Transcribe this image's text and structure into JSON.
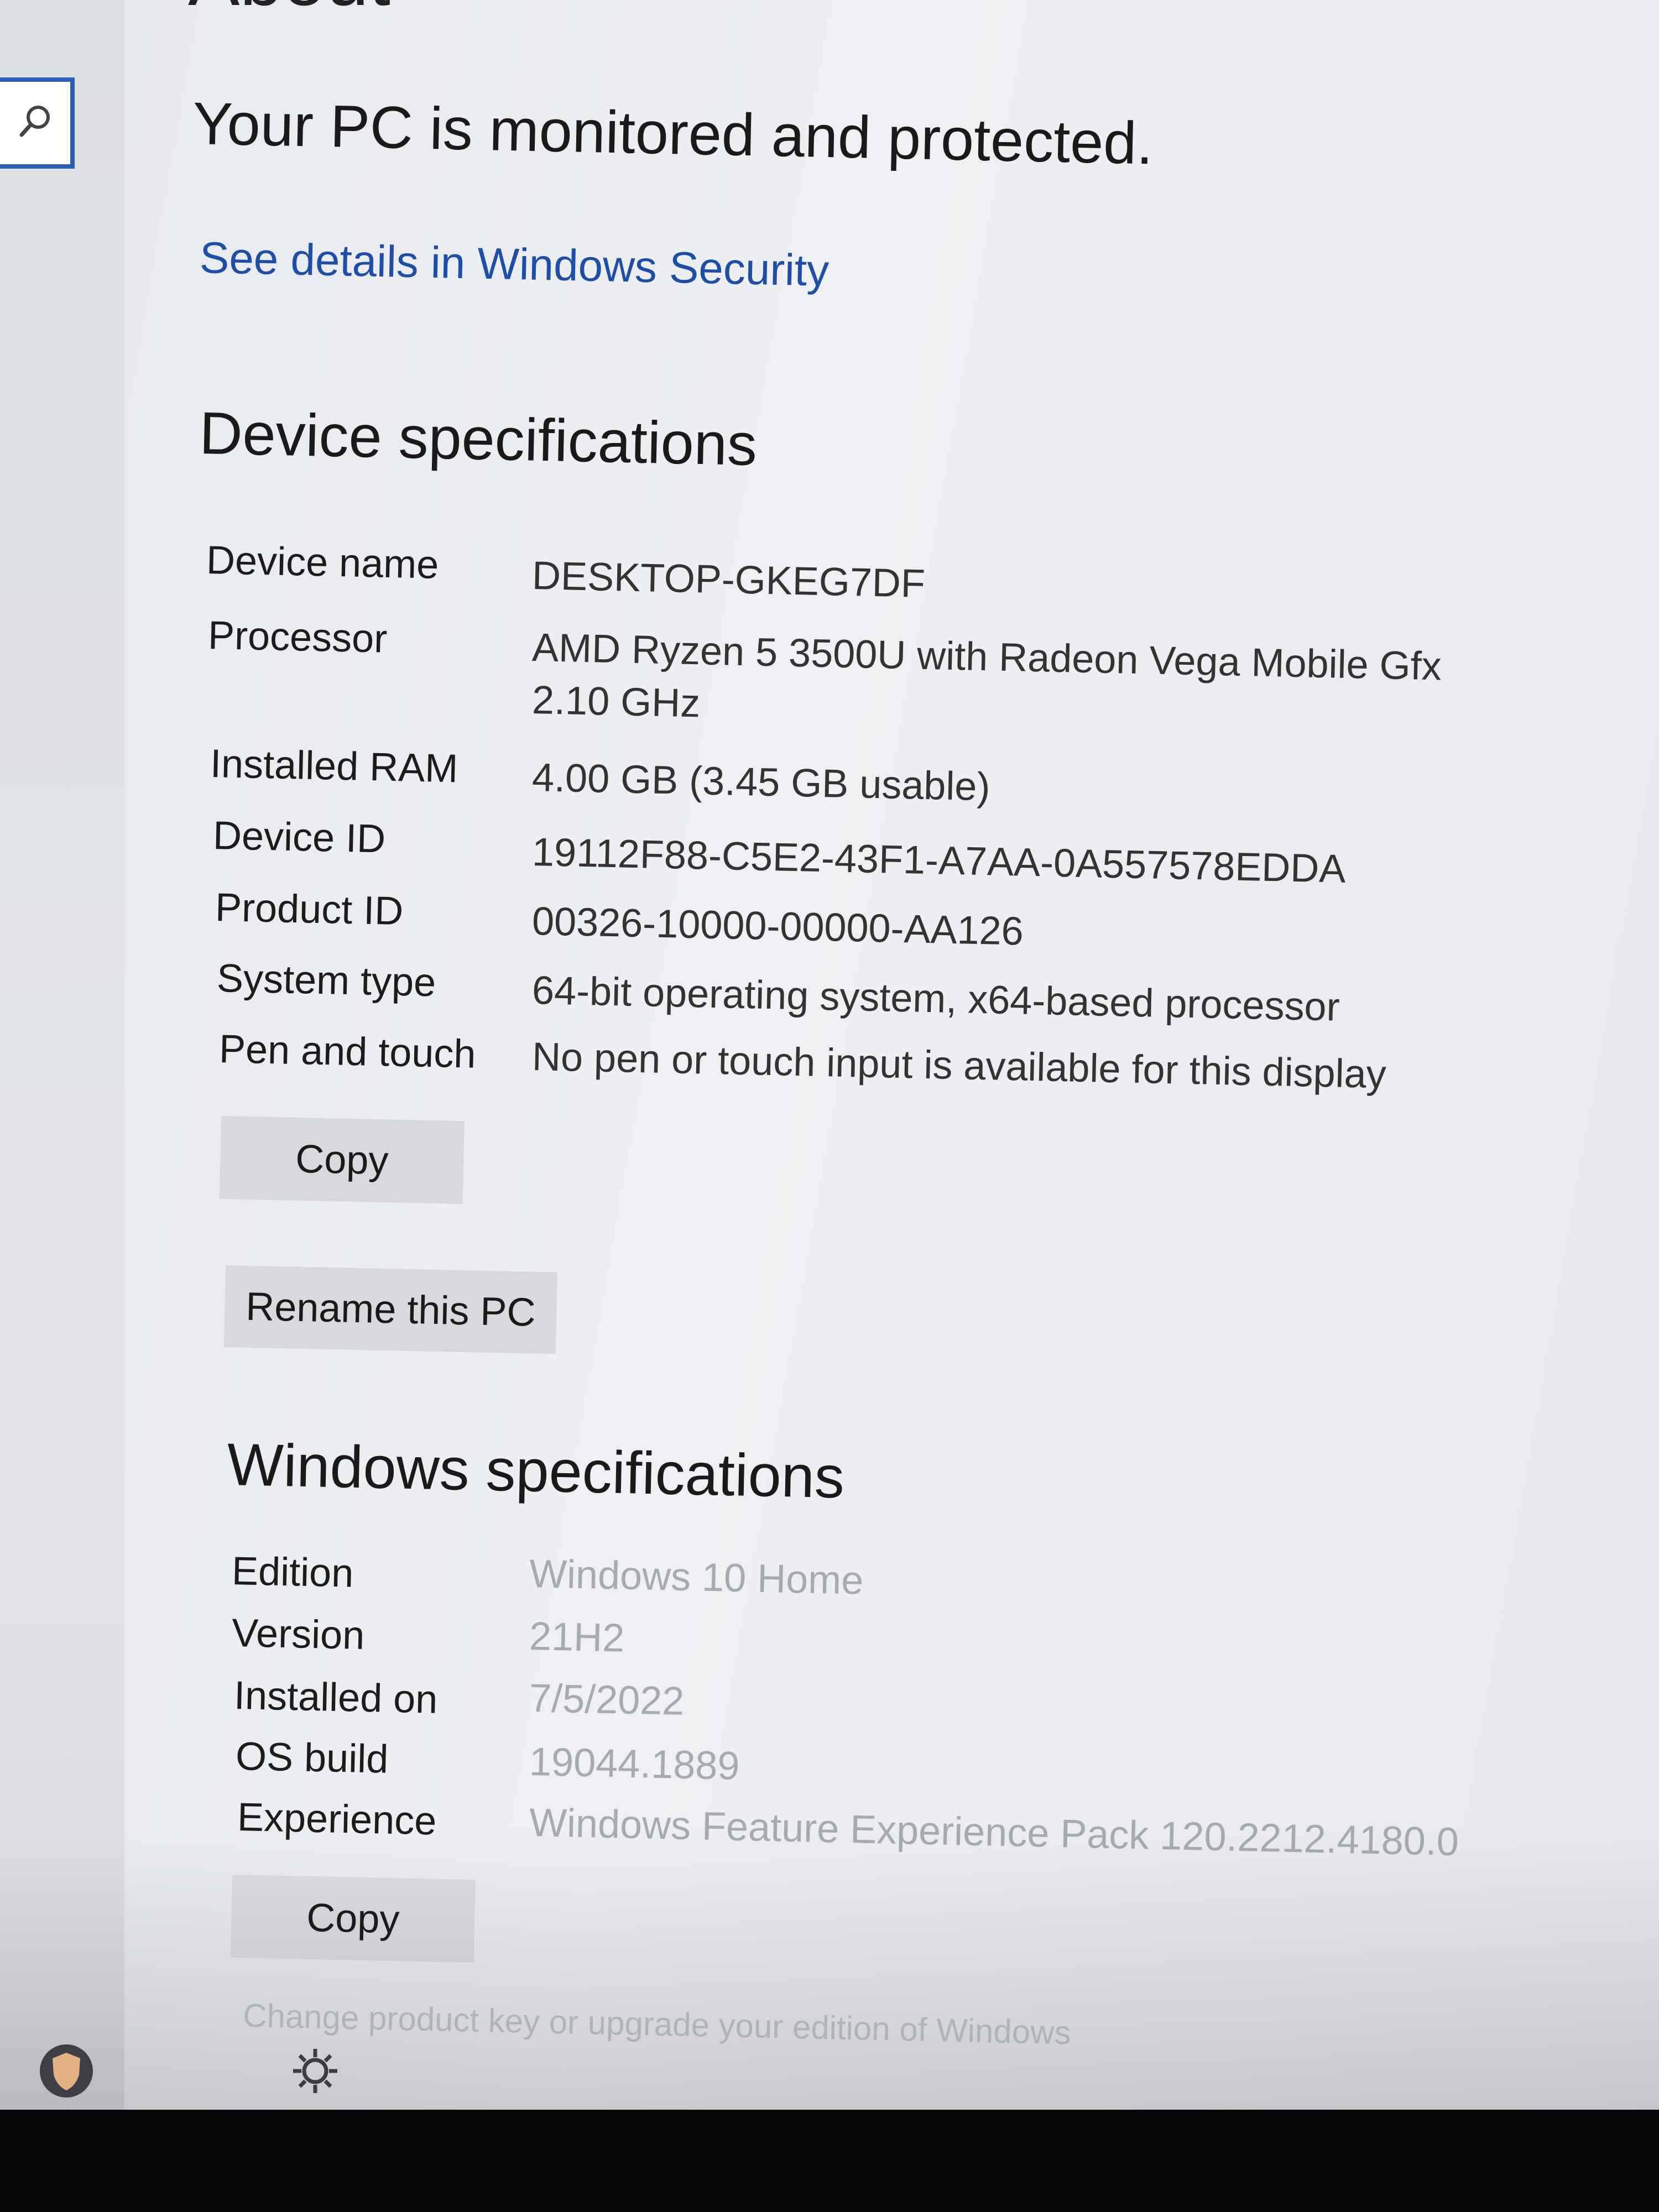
{
  "page": {
    "title_partial": "About"
  },
  "security": {
    "status": "Your PC is monitored and protected.",
    "link": "See details in Windows Security"
  },
  "device": {
    "title": "Device specifications",
    "rows": [
      {
        "label": "Device name",
        "value": "DESKTOP-GKEG7DF"
      },
      {
        "label": "Processor",
        "value": "AMD Ryzen 5 3500U with Radeon Vega Mobile Gfx",
        "value2": "2.10 GHz"
      },
      {
        "label": "Installed RAM",
        "value": "4.00 GB (3.45 GB usable)"
      },
      {
        "label": "Device ID",
        "value": "19112F88-C5E2-43F1-A7AA-0A557578EDDA"
      },
      {
        "label": "Product ID",
        "value": "00326-10000-00000-AA126"
      },
      {
        "label": "System type",
        "value": "64-bit operating system, x64-based processor"
      },
      {
        "label": "Pen and touch",
        "value": "No pen or touch input is available for this display"
      }
    ],
    "copy_label": "Copy",
    "rename_label": "Rename this PC"
  },
  "windows": {
    "title": "Windows specifications",
    "rows": [
      {
        "label": "Edition",
        "value": "Windows 10 Home"
      },
      {
        "label": "Version",
        "value": "21H2"
      },
      {
        "label": "Installed on",
        "value": "7/5/2022"
      },
      {
        "label": "OS build",
        "value": "19044.1889"
      },
      {
        "label": "Experience",
        "value": "Windows Feature Experience Pack 120.2212.4180.0"
      }
    ],
    "copy_label": "Copy",
    "change_key_link": "Change product key or upgrade your edition of Windows"
  },
  "icons": {
    "search": "search-icon",
    "settings": "gear-icon",
    "shield": "shield-icon"
  }
}
